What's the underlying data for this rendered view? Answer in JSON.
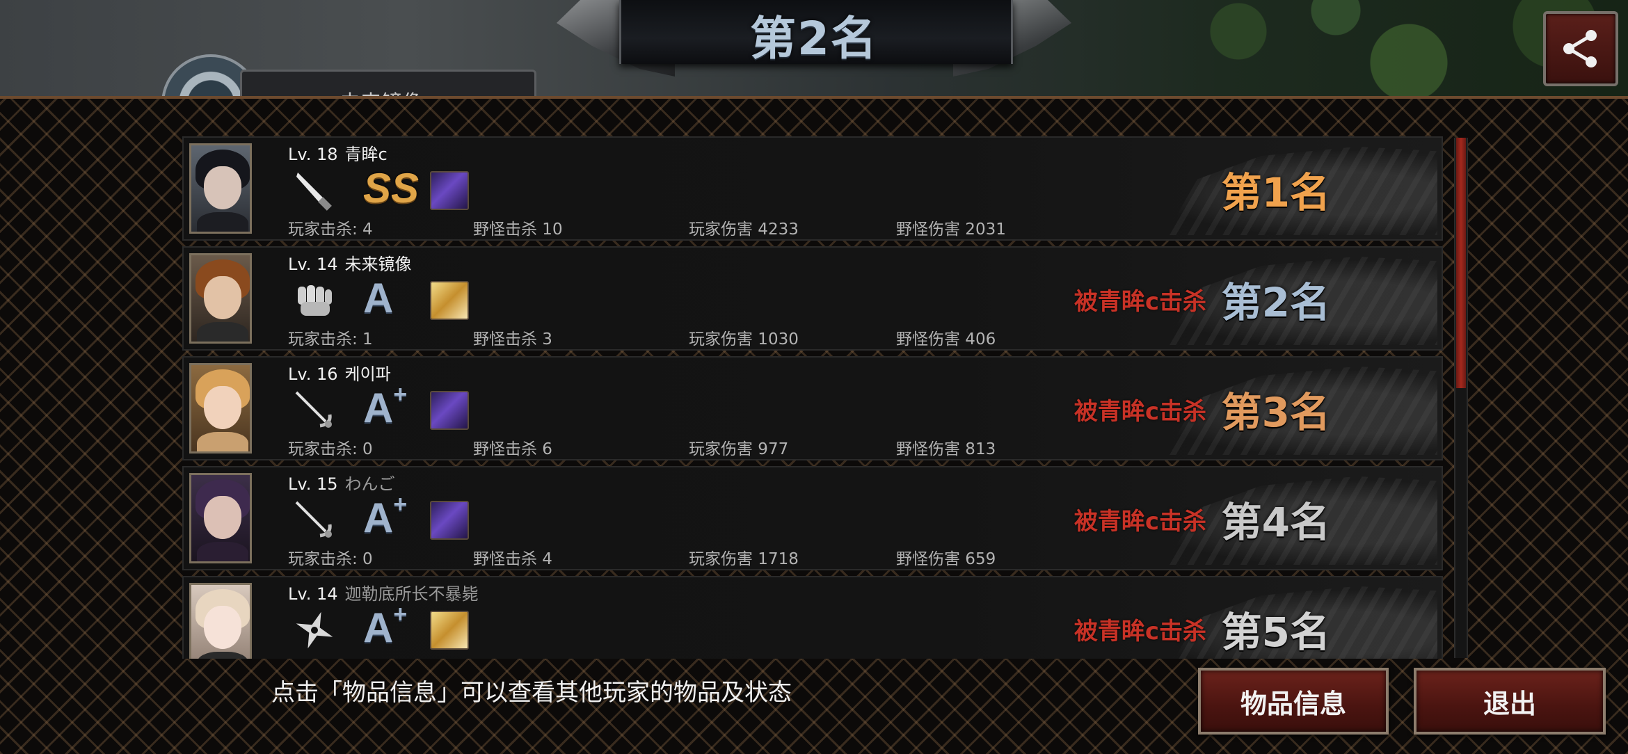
{
  "header": {
    "title": "第2名",
    "background_name": "未来镜像",
    "share_icon": "share-icon"
  },
  "colors": {
    "accent_red": "#c83226",
    "button_red": "#5a1a15",
    "rank_gold": "#f0a24d",
    "rank_blue": "#a9bed4"
  },
  "players": [
    {
      "level": "Lv. 18",
      "name": "青眸c",
      "weapon_icon": "knife-icon",
      "grade": "SS",
      "item_icon": "purple-gun-icon",
      "player_kills_label": "玩家击杀: 4",
      "monster_kills_label": "野怪击杀 10",
      "player_damage_label": "玩家伤害 4233",
      "monster_damage_label": "野怪伤害 2031",
      "killed_by": "",
      "rank": "第1名"
    },
    {
      "level": "Lv. 14",
      "name": "未来镜像",
      "weapon_icon": "fist-icon",
      "grade": "A",
      "item_icon": "gold-item-icon",
      "player_kills_label": "玩家击杀: 1",
      "monster_kills_label": "野怪击杀 3",
      "player_damage_label": "玩家伤害 1030",
      "monster_damage_label": "野怪伤害 406",
      "killed_by": "被青眸c击杀",
      "rank": "第2名"
    },
    {
      "level": "Lv. 16",
      "name": "케이파",
      "weapon_icon": "rapier-icon",
      "grade": "A",
      "grade_plus": "+",
      "item_icon": "purple-gun-icon",
      "player_kills_label": "玩家击杀: 0",
      "monster_kills_label": "野怪击杀 6",
      "player_damage_label": "玩家伤害 977",
      "monster_damage_label": "野怪伤害 813",
      "killed_by": "被青眸c击杀",
      "rank": "第3名"
    },
    {
      "level": "Lv. 15",
      "name": "わんご",
      "weapon_icon": "rapier-icon",
      "grade": "A",
      "grade_plus": "+",
      "item_icon": "purple-gun-icon",
      "player_kills_label": "玩家击杀: 0",
      "monster_kills_label": "野怪击杀 4",
      "player_damage_label": "玩家伤害 1718",
      "monster_damage_label": "野怪伤害 659",
      "killed_by": "被青眸c击杀",
      "rank": "第4名"
    },
    {
      "level": "Lv. 14",
      "name": "迦勒底所长不暴毙",
      "weapon_icon": "shuriken-icon",
      "grade": "A",
      "grade_plus": "+",
      "item_icon": "gold-item-icon",
      "killed_by": "被青眸c击杀",
      "rank": "第5名"
    }
  ],
  "footer": {
    "hint": "点击「物品信息」可以查看其他玩家的物品及状态",
    "item_info_button": "物品信息",
    "exit_button": "退出"
  }
}
